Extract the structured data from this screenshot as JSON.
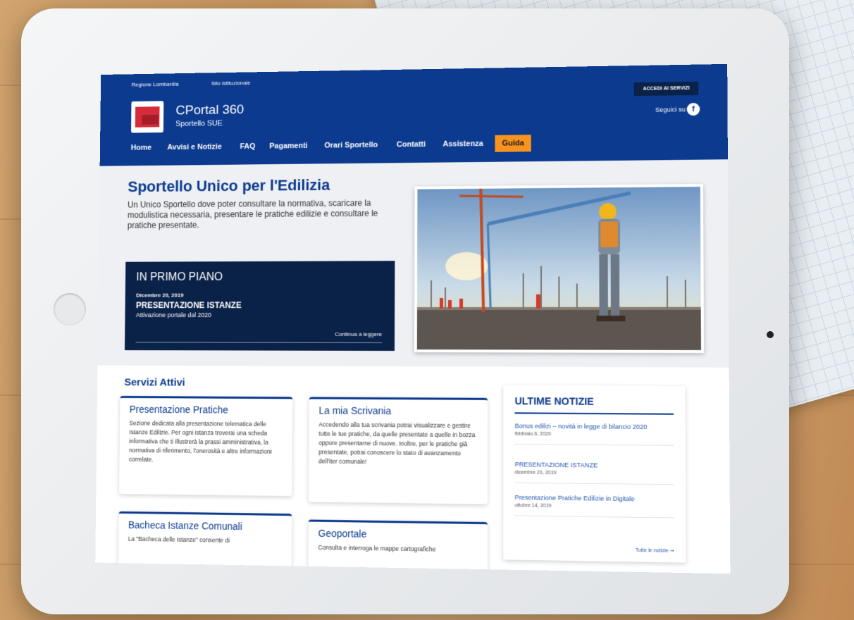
{
  "topbar": {
    "region": "Regione Lombardia",
    "site": "Sito istituzionale",
    "login": "ACCEDI AI SERVIZI"
  },
  "header": {
    "brand_name": "CPortal 360",
    "brand_sub": "Sportello SUE",
    "follow": "Seguici su",
    "facebook_glyph": "f"
  },
  "nav": {
    "items": [
      "Home",
      "Avvisi e Notizie",
      "FAQ",
      "Pagamenti",
      "Orari Sportello",
      "Contatti",
      "Assistenza"
    ],
    "guide": "Guida"
  },
  "hero": {
    "title": "Sportello Unico per l'Edilizia",
    "subtitle": "Un Unico Sportello dove poter consultare la normativa, scaricare la modulistica necessaria, presentare le pratiche edilizie e consultare le pratiche presentate."
  },
  "featured": {
    "heading": "IN PRIMO PIANO",
    "date": "Dicembre 20, 2019",
    "title": "PRESENTAZIONE ISTANZE",
    "subtitle": "Attivazione portale dal 2020",
    "read_more": "Continua a leggere"
  },
  "services": {
    "title": "Servizi Attivi",
    "cards": [
      {
        "title": "Presentazione Pratiche",
        "text": "Sezione dedicata alla presentazione telematica delle Istanze Edilizie. Per ogni istanza troverai una scheda informativa che ti illustrerà la prassi amministrativa, la normativa di riferimento, l'onerosità e altre informazioni correlate."
      },
      {
        "title": "La mia Scrivania",
        "text": "Accedendo alla tua scrivania potrai visualizzare e gestire tutte le tue pratiche, da quelle presentate a quelle in bozza oppure presentarne di nuove. Inoltre, per le pratiche già presentate, potrai conoscere lo stato di avanzamento dell'iter comunale!"
      },
      {
        "title": "Bacheca Istanze Comunali",
        "text": "La \"Bacheca delle Istanze\" consente di"
      },
      {
        "title": "Geoportale",
        "text": "Consulta e interroga le mappe cartografiche"
      }
    ]
  },
  "news": {
    "title": "ULTIME NOTIZIE",
    "items": [
      {
        "title": "Bonus edilizi – novità in legge di bilancio 2020",
        "date": "febbraio 6, 2020"
      },
      {
        "title": "PRESENTAZIONE ISTANZE",
        "date": "dicembre 20, 2019"
      },
      {
        "title": "Presentazione Pratiche Edilizie in Digitale",
        "date": "ottobre 14, 2019"
      }
    ],
    "all": "Tutte le notizie ➞"
  },
  "colors": {
    "primary": "#0b3a8f",
    "dark": "#0a2148",
    "accent": "#f7931e"
  }
}
